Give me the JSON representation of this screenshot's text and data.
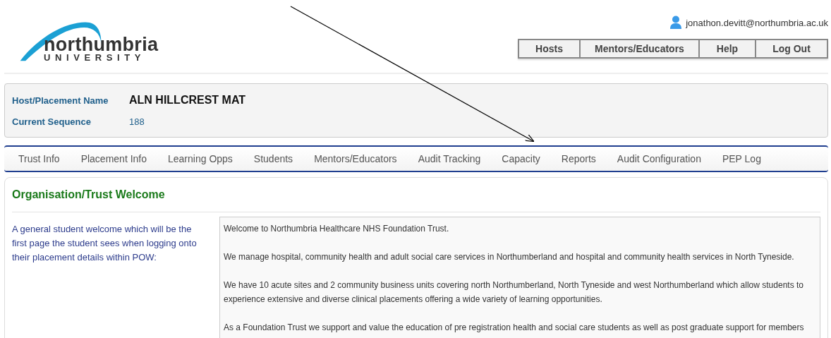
{
  "logo": {
    "name": "northumbria",
    "subtitle": "UNIVERSITY"
  },
  "user": {
    "email": "jonathon.devitt@northumbria.ac.uk"
  },
  "top_buttons": [
    "Hosts",
    "Mentors/Educators",
    "Help",
    "Log Out"
  ],
  "info_panel": {
    "fields": [
      {
        "label": "Host/Placement Name",
        "value": "ALN HILLCREST MAT",
        "kind": "title"
      },
      {
        "label": "Current Sequence",
        "value": "188",
        "kind": "plain"
      }
    ]
  },
  "tabs": [
    {
      "label": "Trust Info",
      "selected": false
    },
    {
      "label": "Placement Info",
      "selected": false
    },
    {
      "label": "Learning Opps",
      "selected": false
    },
    {
      "label": "Students",
      "selected": false
    },
    {
      "label": "Mentors/Educators",
      "selected": false
    },
    {
      "label": "Audit Tracking",
      "selected": false
    },
    {
      "label": "Capacity",
      "selected": false
    },
    {
      "label": "Reports",
      "selected": false
    },
    {
      "label": "Audit Configuration",
      "selected": false
    },
    {
      "label": "PEP Log",
      "selected": false
    }
  ],
  "section": {
    "title": "Organisation/Trust Welcome",
    "description": "A general student welcome which will be the first page the student sees when logging onto their placement details within POW:",
    "welcome_text": [
      "Welcome to Northumbria Healthcare NHS Foundation Trust.",
      "We manage hospital, community health and adult social care services in Northumberland and hospital and community health services in North Tyneside.",
      "We have 10 acute sites and 2 community business units covering north Northumberland, North Tyneside and west Northumberland which allow students to experience extensive and diverse clinical placements offering a wide variety of learning opportunities.",
      "As a Foundation Trust we support and value the education of pre registration health and social care students as well as post graduate support for members"
    ]
  }
}
